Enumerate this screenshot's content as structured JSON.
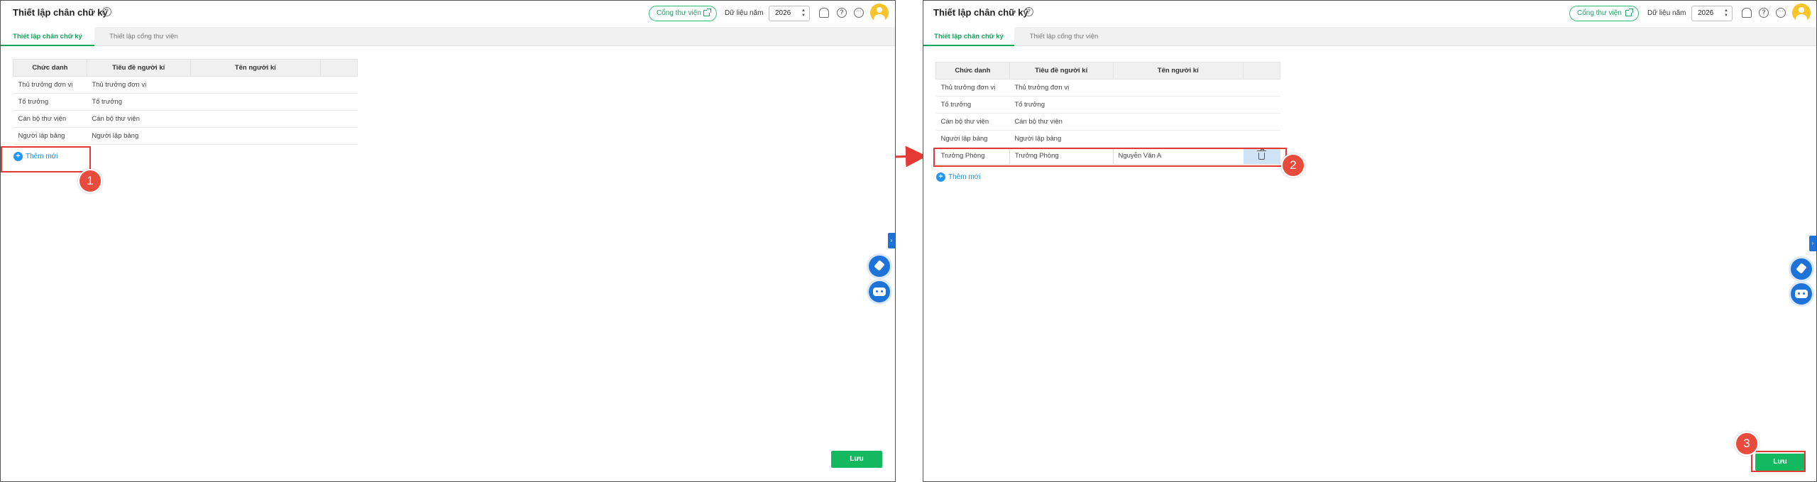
{
  "page_title": "Thiết lập chân chữ ký",
  "header": {
    "help": "?",
    "library_portal": "Cổng thư viện",
    "year_label": "Dữ liệu năm",
    "year_value": "2026",
    "spin_up": "▲",
    "spin_down": "▼",
    "icons": [
      "bell-icon",
      "help-circle-icon",
      "more-icon",
      "avatar"
    ]
  },
  "tabs": [
    {
      "label": "Thiết lập chân chữ ký",
      "active": true
    },
    {
      "label": "Thiết lập cổng thư viện",
      "active": false
    }
  ],
  "table": {
    "headers": [
      "Chức danh",
      "Tiêu đề người kí",
      "Tên người kí",
      ""
    ],
    "rows": [
      {
        "title": "Thủ trưởng đơn vị",
        "signer_title": "Thủ trưởng đơn vị",
        "signer_name": ""
      },
      {
        "title": "Tổ trưởng",
        "signer_title": "Tổ trưởng",
        "signer_name": ""
      },
      {
        "title": "Cán bộ thư viện",
        "signer_title": "Cán bộ thư viện",
        "signer_name": ""
      },
      {
        "title": "Người lập bảng",
        "signer_title": "Người lập bảng",
        "signer_name": ""
      }
    ],
    "new_row": {
      "title": "Trưởng Phòng",
      "signer_title": "Trưởng Phòng",
      "signer_name": "Nguyễn Văn A"
    }
  },
  "add_new": {
    "plus": "+",
    "label": "Thêm mới"
  },
  "side_toggle": "›",
  "save_label": "Lưu",
  "step_badges": [
    "1",
    "2",
    "3"
  ],
  "colors": {
    "accent": "#17a35b",
    "link": "#1a8fd6",
    "highlight": "#e53935",
    "badge": "#e84b3c",
    "float": "#1e73d8"
  }
}
